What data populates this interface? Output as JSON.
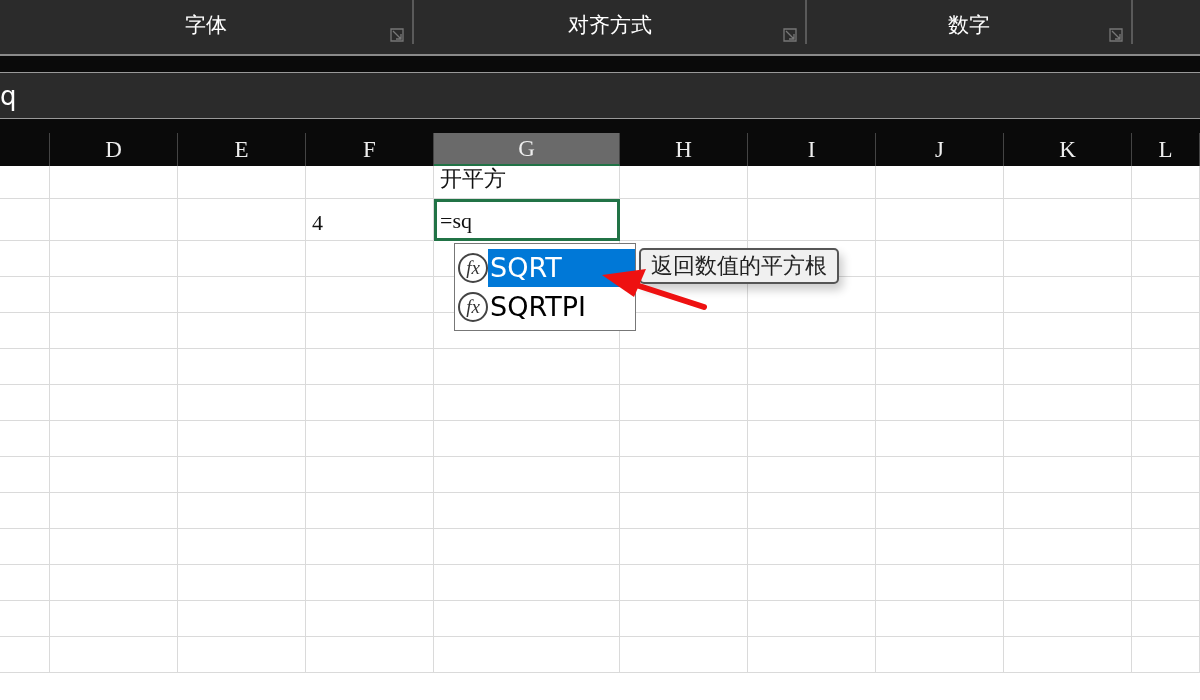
{
  "ribbon": {
    "groups": [
      {
        "label": "字体"
      },
      {
        "label": "对齐方式"
      },
      {
        "label": "数字"
      }
    ]
  },
  "formula_bar": {
    "value": "q"
  },
  "columns": [
    {
      "label": "D",
      "selected": false
    },
    {
      "label": "E",
      "selected": false
    },
    {
      "label": "F",
      "selected": false
    },
    {
      "label": "G",
      "selected": true
    },
    {
      "label": "H",
      "selected": false
    },
    {
      "label": "I",
      "selected": false
    },
    {
      "label": "J",
      "selected": false
    },
    {
      "label": "K",
      "selected": false
    },
    {
      "label": "L",
      "selected": false
    }
  ],
  "rows": [
    {
      "cells": [
        null,
        null,
        null,
        {
          "text": "开平方",
          "editing": false
        }
      ]
    },
    {
      "cells": [
        null,
        null,
        {
          "text": "4",
          "editing": false
        },
        {
          "text": "=sq",
          "editing": true
        }
      ]
    }
  ],
  "autocomplete": {
    "items": [
      {
        "icon": "fx",
        "name": "SQRT",
        "selected": true
      },
      {
        "icon": "fx",
        "name": "SQRTPI",
        "selected": false
      }
    ],
    "tooltip": "返回数值的平方根"
  }
}
